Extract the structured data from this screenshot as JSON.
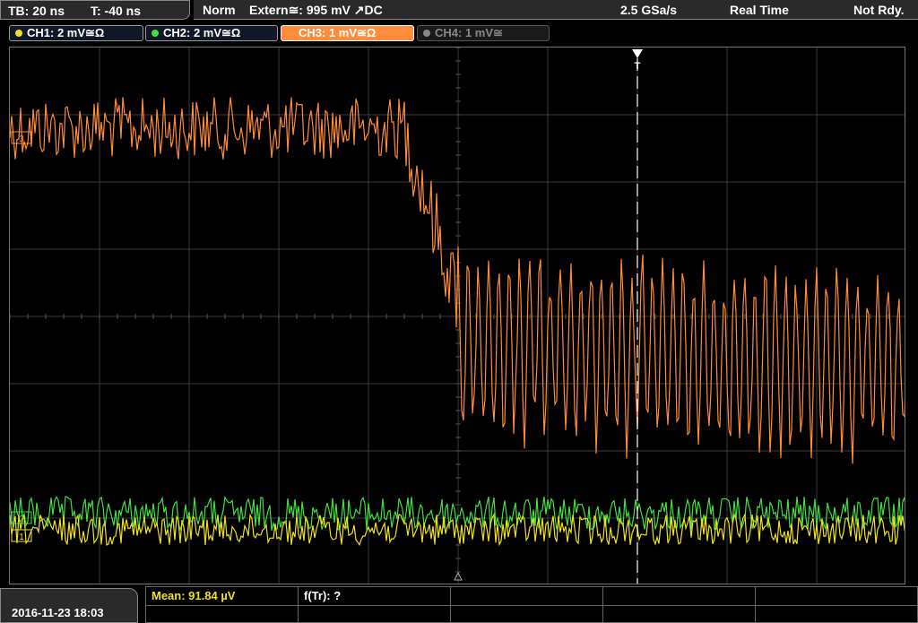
{
  "top": {
    "timebase": "TB: 20 ns",
    "trigger_pos": "T: -40 ns",
    "trigger_mode": "Norm",
    "trigger_source": "Extern≅: 995 mV ↗DC",
    "sample_rate": "2.5 GSa/s",
    "acq_mode": "Real Time",
    "status": "Not Rdy."
  },
  "channels": [
    {
      "label": "CH1: 2 mV≅Ω",
      "color": "#f0e020",
      "active": false
    },
    {
      "label": "CH2: 2 mV≅Ω",
      "color": "#40e040",
      "active": false
    },
    {
      "label": "CH3: 1 mV≅Ω",
      "color": "#ff8c3a",
      "active": true
    },
    {
      "label": "CH4: 1 mV≅",
      "color": "#888888",
      "active": false
    }
  ],
  "markers": {
    "trigger": "T",
    "ch3_level": "3",
    "ch2_level": "2",
    "ch1_level": "1"
  },
  "bottom": {
    "datetime": "2016-11-23 18:03",
    "mean": "Mean: 91.84 µV",
    "ftr": "f(Tr): ?"
  },
  "colors": {
    "ch1": "#f0e020",
    "ch2": "#40e040",
    "ch3": "#ff8c3a",
    "grid": "#3a3a3a"
  }
}
